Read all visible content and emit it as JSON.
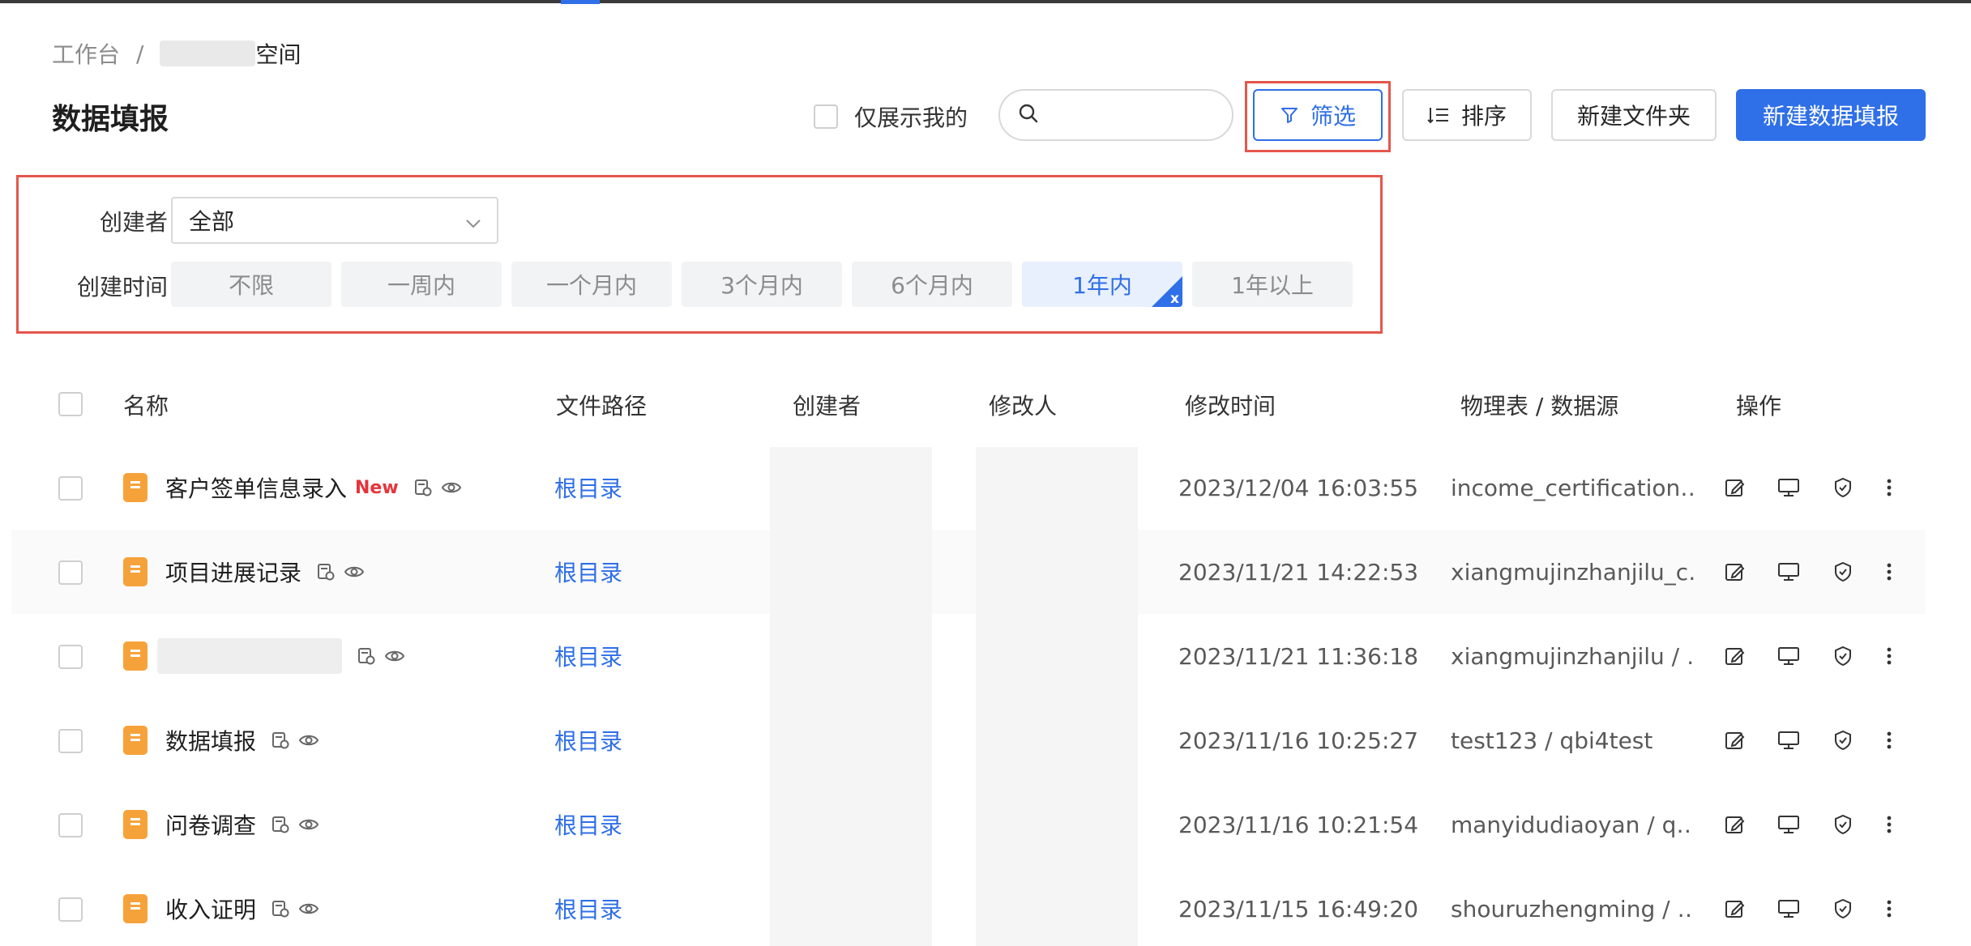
{
  "breadcrumb": {
    "root": "工作台",
    "separator": "/",
    "current": "空间"
  },
  "page_title": "数据填报",
  "toolbar": {
    "only_mine_label": "仅展示我的",
    "search_placeholder": "",
    "filter_label": "筛选",
    "sort_label": "排序",
    "new_folder_label": "新建文件夹",
    "new_report_label": "新建数据填报"
  },
  "filters": {
    "creator_label": "创建者",
    "creator_value": "全部",
    "time_label": "创建时间",
    "time_options": [
      "不限",
      "一周内",
      "一个月内",
      "3个月内",
      "6个月内",
      "1年内",
      "1年以上"
    ],
    "time_selected": "1年内",
    "clear_mark": "x"
  },
  "table": {
    "headers": {
      "name": "名称",
      "path": "文件路径",
      "creator": "创建者",
      "modifier": "修改人",
      "modified_time": "修改时间",
      "source": "物理表 / 数据源",
      "actions": "操作"
    },
    "rows": [
      {
        "name": "客户签单信息录入",
        "badge": "New",
        "path": "根目录",
        "modified_time": "2023/12/04 16:03:55",
        "source": "income_certification…"
      },
      {
        "name": "项目进展记录",
        "badge": "",
        "path": "根目录",
        "modified_time": "2023/11/21 14:22:53",
        "source": "xiangmujinzhanjilu_c…"
      },
      {
        "name": "",
        "badge": "",
        "path": "根目录",
        "modified_time": "2023/11/21 11:36:18",
        "source": "xiangmujinzhanjilu / …"
      },
      {
        "name": "数据填报",
        "badge": "",
        "path": "根目录",
        "modified_time": "2023/11/16 10:25:27",
        "source": "test123 / qbi4test"
      },
      {
        "name": "问卷调查",
        "badge": "",
        "path": "根目录",
        "modified_time": "2023/11/16 10:21:54",
        "source": "manyidudiaoyan / q…"
      },
      {
        "name": "收入证明",
        "badge": "",
        "path": "根目录",
        "modified_time": "2023/11/15 16:49:20",
        "source": "shouruzhengming / …"
      }
    ]
  },
  "colors": {
    "accent": "#2f6fe8",
    "highlight_frame": "#e5564c",
    "file_icon": "#f6a23b",
    "new_badge": "#e5343a"
  }
}
